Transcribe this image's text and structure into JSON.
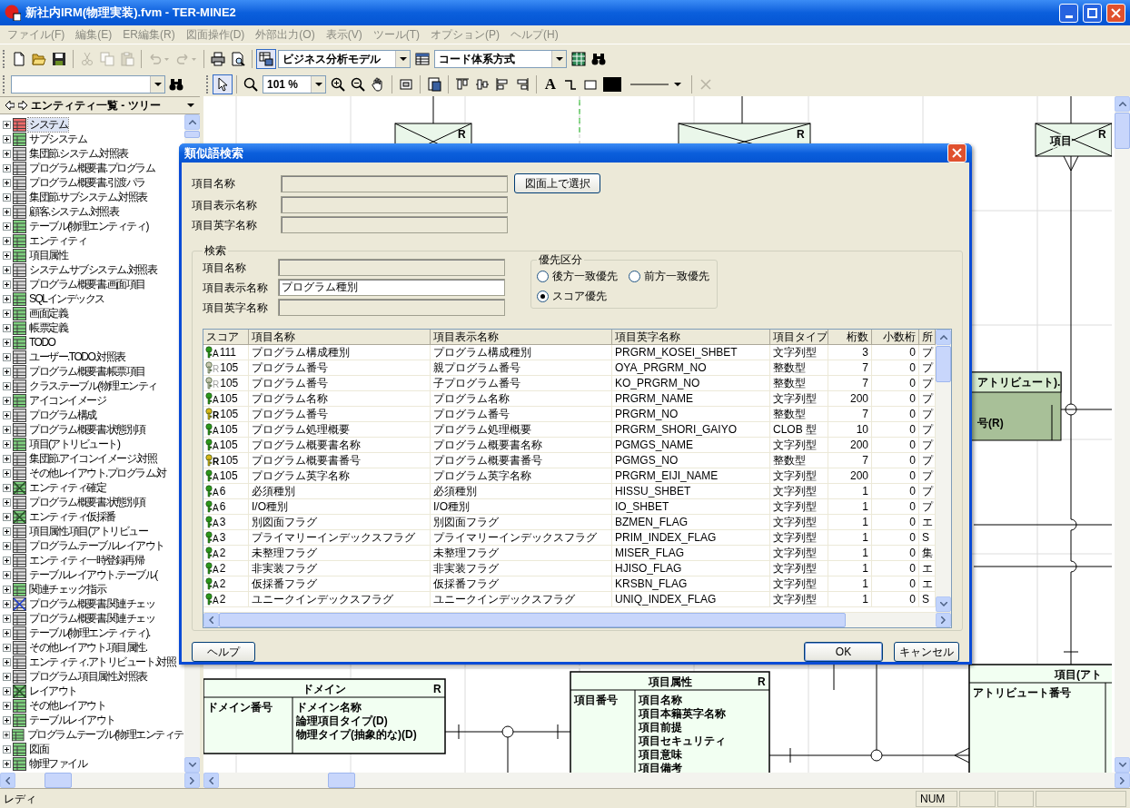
{
  "window": {
    "title": "新社内IRM(物理実装).fvm - TER-MINE2"
  },
  "menu": [
    "ファイル(F)",
    "編集(E)",
    "ER編集(R)",
    "図面操作(D)",
    "外部出力(O)",
    "表示(V)",
    "ツール(T)",
    "オプション(P)",
    "ヘルプ(H)"
  ],
  "toolbar": [
    [
      {
        "kind": "new",
        "disabled": false,
        "pressed": false
      },
      {
        "kind": "open",
        "disabled": false,
        "pressed": false
      },
      {
        "kind": "save",
        "disabled": false,
        "pressed": false
      }
    ],
    [
      {
        "kind": "cut",
        "disabled": true,
        "pressed": false
      },
      {
        "kind": "copy",
        "disabled": true,
        "pressed": false
      },
      {
        "kind": "paste",
        "disabled": true,
        "pressed": false
      }
    ],
    [
      {
        "kind": "undo",
        "disabled": true,
        "pressed": false
      },
      {
        "kind": "redo",
        "disabled": true,
        "pressed": false
      }
    ],
    [
      {
        "kind": "print",
        "disabled": false,
        "pressed": false
      },
      {
        "kind": "preview",
        "disabled": false,
        "pressed": false
      }
    ],
    [
      {
        "kind": "model",
        "disabled": false,
        "pressed": true
      },
      {
        "kind": "combo",
        "value": "ビジネス分析モデル",
        "disabled": false,
        "pressed": false
      },
      {
        "kind": "table",
        "disabled": false,
        "pressed": false
      },
      {
        "kind": "combo",
        "value": "コード体系方式",
        "disabled": false,
        "pressed": false
      },
      {
        "kind": "grid",
        "disabled": false,
        "pressed": false
      },
      {
        "kind": "binoculars",
        "disabled": false,
        "pressed": false
      }
    ]
  ],
  "tree_panel": {
    "title": "エンティティ一覧 - ツリー",
    "items": [
      {
        "label": "システム",
        "kind": "red",
        "expanded": false,
        "selected": true
      },
      {
        "label": "サブシステム",
        "kind": "green",
        "expanded": false,
        "selected": false
      },
      {
        "label": "集団節.システム.対照表",
        "kind": "gray",
        "expanded": false,
        "selected": false
      },
      {
        "label": "プログラム概要書.プログラム",
        "kind": "gray",
        "expanded": false,
        "selected": false
      },
      {
        "label": "プログラム概要書.引渡パラ",
        "kind": "gray",
        "expanded": false,
        "selected": false
      },
      {
        "label": "集団節.サブシステム.対照表",
        "kind": "gray",
        "expanded": false,
        "selected": false
      },
      {
        "label": "顧客.システム.対照表",
        "kind": "gray",
        "expanded": false,
        "selected": false
      },
      {
        "label": "テーブル(物理エンティティ)",
        "kind": "green",
        "expanded": false,
        "selected": false
      },
      {
        "label": "エンティティ",
        "kind": "green",
        "expanded": false,
        "selected": false
      },
      {
        "label": "項目属性",
        "kind": "green",
        "expanded": false,
        "selected": false
      },
      {
        "label": "システム.サブシステム.対照表",
        "kind": "gray",
        "expanded": false,
        "selected": false
      },
      {
        "label": "プログラム概要書.画面項目",
        "kind": "gray",
        "expanded": false,
        "selected": false
      },
      {
        "label": "SQLインデックス",
        "kind": "green",
        "expanded": false,
        "selected": false
      },
      {
        "label": "画面定義",
        "kind": "green",
        "expanded": false,
        "selected": false
      },
      {
        "label": "帳票定義",
        "kind": "green",
        "expanded": false,
        "selected": false
      },
      {
        "label": "TODO",
        "kind": "green",
        "expanded": false,
        "selected": false
      },
      {
        "label": "ユーザー.TODO.対照表",
        "kind": "gray",
        "expanded": false,
        "selected": false
      },
      {
        "label": "プログラム概要書.帳票項目",
        "kind": "gray",
        "expanded": false,
        "selected": false
      },
      {
        "label": "クラス.テーブル(物理エンティ",
        "kind": "gray",
        "expanded": false,
        "selected": false
      },
      {
        "label": "アイコンイメージ",
        "kind": "green",
        "expanded": false,
        "selected": false
      },
      {
        "label": "プログラム構成",
        "kind": "gray",
        "expanded": false,
        "selected": false
      },
      {
        "label": "プログラム概要書.状態別項",
        "kind": "gray",
        "expanded": false,
        "selected": false
      },
      {
        "label": "項目(アトリビュート)",
        "kind": "green",
        "expanded": false,
        "selected": false
      },
      {
        "label": "集団節.アイコンイメージ.対照",
        "kind": "gray",
        "expanded": false,
        "selected": false
      },
      {
        "label": "その他レイアウト.プログラム.対",
        "kind": "gray",
        "expanded": false,
        "selected": false
      },
      {
        "label": "エンティティ確定",
        "kind": "crossed",
        "expanded": false,
        "selected": false
      },
      {
        "label": "プログラム概要書.状態別項",
        "kind": "gray",
        "expanded": false,
        "selected": false
      },
      {
        "label": "エンティティ仮採番",
        "kind": "crossed",
        "expanded": false,
        "selected": false
      },
      {
        "label": "項目属性.項目(アトリビュー",
        "kind": "gray",
        "expanded": false,
        "selected": false
      },
      {
        "label": "プログラム.テーブルレイアウト",
        "kind": "gray",
        "expanded": false,
        "selected": false
      },
      {
        "label": "エンティティ一時登録再帰",
        "kind": "gray",
        "expanded": false,
        "selected": false
      },
      {
        "label": "テーブルレイアウト.テーブル(",
        "kind": "gray",
        "expanded": false,
        "selected": false
      },
      {
        "label": "関連チェック指示",
        "kind": "green",
        "expanded": false,
        "selected": false
      },
      {
        "label": "プログラム概要書.関連チェッ",
        "kind": "crossed_blue",
        "expanded": false,
        "selected": false
      },
      {
        "label": "プログラム概要書.関連チェッ",
        "kind": "gray",
        "expanded": false,
        "selected": false
      },
      {
        "label": "テーブル(物理エンティティ).",
        "kind": "gray",
        "expanded": false,
        "selected": false
      },
      {
        "label": "その他レイアウト.項目属性.",
        "kind": "gray",
        "expanded": false,
        "selected": false
      },
      {
        "label": "エンティティ.アトリビュート.対照",
        "kind": "gray",
        "expanded": false,
        "selected": false
      },
      {
        "label": "プログラム.項目属性.対照表",
        "kind": "gray",
        "expanded": false,
        "selected": false
      },
      {
        "label": "レイアウト",
        "kind": "crossed",
        "expanded": false,
        "selected": false
      },
      {
        "label": "その他レイアウト",
        "kind": "green",
        "expanded": false,
        "selected": false
      },
      {
        "label": "テーブルレイアウト",
        "kind": "green",
        "expanded": false,
        "selected": false
      },
      {
        "label": "プログラム.テーブル(物理エンティテ",
        "kind": "green",
        "expanded": false,
        "selected": false
      },
      {
        "label": "図面",
        "kind": "green",
        "expanded": false,
        "selected": false
      },
      {
        "label": "物理ファイル",
        "kind": "green",
        "expanded": false,
        "selected": false
      }
    ]
  },
  "diagram_toolbar": [
    [
      {
        "kind": "pointer",
        "disabled": false,
        "pressed": true
      }
    ],
    [
      {
        "kind": "zoom",
        "disabled": false,
        "pressed": false
      },
      {
        "kind": "combo",
        "value": "101 %",
        "disabled": false,
        "pressed": false
      },
      {
        "kind": "zoom_in",
        "disabled": false,
        "pressed": false
      },
      {
        "kind": "zoom_out",
        "disabled": false,
        "pressed": false
      },
      {
        "kind": "hand",
        "disabled": false,
        "pressed": false
      }
    ],
    [
      {
        "kind": "fit",
        "disabled": false,
        "pressed": false
      }
    ],
    [
      {
        "kind": "page",
        "disabled": false,
        "pressed": false
      }
    ],
    [
      {
        "kind": "align_top",
        "disabled": false,
        "pressed": false
      },
      {
        "kind": "align_mid",
        "disabled": false,
        "pressed": false
      },
      {
        "kind": "align_left",
        "disabled": false,
        "pressed": false
      },
      {
        "kind": "align_right",
        "disabled": false,
        "pressed": false
      }
    ],
    [
      {
        "kind": "text_tool",
        "label": "A",
        "disabled": false,
        "pressed": false
      },
      {
        "kind": "connector",
        "disabled": false,
        "pressed": false
      },
      {
        "kind": "rect",
        "disabled": false,
        "pressed": false
      },
      {
        "kind": "color",
        "disabled": false,
        "pressed": false
      },
      {
        "kind": "line_combo",
        "disabled": false,
        "pressed": false
      }
    ],
    [
      {
        "kind": "delete",
        "disabled": true,
        "pressed": false
      }
    ]
  ],
  "diagram": {
    "entities": [
      {
        "kind": "view",
        "marker": "R"
      },
      {
        "kind": "view",
        "marker": "R"
      },
      {
        "kind": "view",
        "title": "項目",
        "marker": "R"
      },
      {
        "kind": "dark",
        "title": "アトリビュート).",
        "attributes": [
          "号(R)"
        ]
      },
      {
        "kind": "entity",
        "title": "ドメイン",
        "marker": "R",
        "keys": [
          "ドメイン番号"
        ],
        "attributes": [
          "ドメイン名称",
          "論理項目タイプ(D)",
          "物理タイプ(抽象的な)(D)"
        ]
      },
      {
        "kind": "entity",
        "title": "項目属性",
        "marker": "R",
        "keys": [
          "項目番号"
        ],
        "attributes": [
          "項目名称",
          "項目本籍英字名称",
          "項目前提",
          "項目セキュリティ",
          "項目意味",
          "項目備考"
        ]
      },
      {
        "kind": "entity",
        "title": "項目(アト",
        "keys": [
          "アトリビュート番号"
        ]
      }
    ]
  },
  "dialog": {
    "title": "類似語検索",
    "fields": [
      {
        "label": "項目名称",
        "disabled": true
      },
      {
        "label": "項目表示名称",
        "disabled": true
      },
      {
        "label": "項目英字名称",
        "disabled": true
      }
    ],
    "select_button": "図面上で選択",
    "search": {
      "title": "検索",
      "fields": [
        {
          "label": "項目名称",
          "disabled": true
        },
        {
          "label": "項目表示名称",
          "value": "プログラム種別",
          "disabled": false
        },
        {
          "label": "項目英字名称",
          "disabled": true
        }
      ],
      "priority": {
        "title": "優先区分",
        "options": [
          {
            "label": "後方一致優先",
            "selected": false
          },
          {
            "label": "前方一致優先",
            "selected": false
          },
          {
            "label": "スコア優先",
            "selected": true
          }
        ]
      }
    },
    "results": {
      "columns": [
        "スコア",
        "項目名称",
        "項目表示名称",
        "項目英字名称",
        "項目タイプ",
        "桁数",
        "小数桁",
        "所"
      ],
      "rows": [
        {
          "kind": "attribute",
          "key_letter": "A",
          "cells": [
            "111",
            "プログラム構成種別",
            "プログラム構成種別",
            "PRGRM_KOSEI_SHBET",
            "文字列型",
            "3",
            "0",
            "プ"
          ]
        },
        {
          "kind": "faded",
          "key_letter": "R",
          "cells": [
            "105",
            "プログラム番号",
            "親プログラム番号",
            "OYA_PRGRM_NO",
            "整数型",
            "7",
            "0",
            "プ"
          ]
        },
        {
          "kind": "faded",
          "key_letter": "R",
          "cells": [
            "105",
            "プログラム番号",
            "子プログラム番号",
            "KO_PRGRM_NO",
            "整数型",
            "7",
            "0",
            "プ"
          ]
        },
        {
          "kind": "attribute",
          "key_letter": "A",
          "cells": [
            "105",
            "プログラム名称",
            "プログラム名称",
            "PRGRM_NAME",
            "文字列型",
            "200",
            "0",
            "プ"
          ]
        },
        {
          "kind": "reference",
          "key_letter": "R",
          "cells": [
            "105",
            "プログラム番号",
            "プログラム番号",
            "PRGRM_NO",
            "整数型",
            "7",
            "0",
            "プ"
          ]
        },
        {
          "kind": "attribute",
          "key_letter": "A",
          "cells": [
            "105",
            "プログラム処理概要",
            "プログラム処理概要",
            "PRGRM_SHORI_GAIYO",
            "CLOB 型",
            "10",
            "0",
            "プ"
          ]
        },
        {
          "kind": "attribute",
          "key_letter": "A",
          "cells": [
            "105",
            "プログラム概要書名称",
            "プログラム概要書名称",
            "PGMGS_NAME",
            "文字列型",
            "200",
            "0",
            "プ"
          ]
        },
        {
          "kind": "reference",
          "key_letter": "R",
          "cells": [
            "105",
            "プログラム概要書番号",
            "プログラム概要書番号",
            "PGMGS_NO",
            "整数型",
            "7",
            "0",
            "プ"
          ]
        },
        {
          "kind": "attribute",
          "key_letter": "A",
          "cells": [
            "105",
            "プログラム英字名称",
            "プログラム英字名称",
            "PRGRM_EIJI_NAME",
            "文字列型",
            "200",
            "0",
            "プ"
          ]
        },
        {
          "kind": "attribute",
          "key_letter": "A",
          "cells": [
            "6",
            "必須種別",
            "必須種別",
            "HISSU_SHBET",
            "文字列型",
            "1",
            "0",
            "プ"
          ]
        },
        {
          "kind": "attribute",
          "key_letter": "A",
          "cells": [
            "6",
            "I/O種別",
            "I/O種別",
            "IO_SHBET",
            "文字列型",
            "1",
            "0",
            "プ"
          ]
        },
        {
          "kind": "attribute",
          "key_letter": "A",
          "cells": [
            "3",
            "別図面フラグ",
            "別図面フラグ",
            "BZMEN_FLAG",
            "文字列型",
            "1",
            "0",
            "エ"
          ]
        },
        {
          "kind": "attribute",
          "key_letter": "A",
          "cells": [
            "3",
            "プライマリーインデックスフラグ",
            "プライマリーインデックスフラグ",
            "PRIM_INDEX_FLAG",
            "文字列型",
            "1",
            "0",
            "S"
          ]
        },
        {
          "kind": "attribute",
          "key_letter": "A",
          "cells": [
            "2",
            "未整理フラグ",
            "未整理フラグ",
            "MISER_FLAG",
            "文字列型",
            "1",
            "0",
            "集"
          ]
        },
        {
          "kind": "attribute",
          "key_letter": "A",
          "cells": [
            "2",
            "非実装フラグ",
            "非実装フラグ",
            "HJISO_FLAG",
            "文字列型",
            "1",
            "0",
            "エ"
          ]
        },
        {
          "kind": "attribute",
          "key_letter": "A",
          "cells": [
            "2",
            "仮採番フラグ",
            "仮採番フラグ",
            "KRSBN_FLAG",
            "文字列型",
            "1",
            "0",
            "エ"
          ]
        },
        {
          "kind": "attribute",
          "key_letter": "A",
          "cells": [
            "2",
            "ユニークインデックスフラグ",
            "ユニークインデックスフラグ",
            "UNIQ_INDEX_FLAG",
            "文字列型",
            "1",
            "0",
            "S"
          ]
        }
      ]
    },
    "buttons": {
      "help": "ヘルプ",
      "ok": "OK",
      "cancel": "キャンセル"
    }
  },
  "status_bar": {
    "text": "レディ",
    "panels": [
      "NUM"
    ]
  }
}
